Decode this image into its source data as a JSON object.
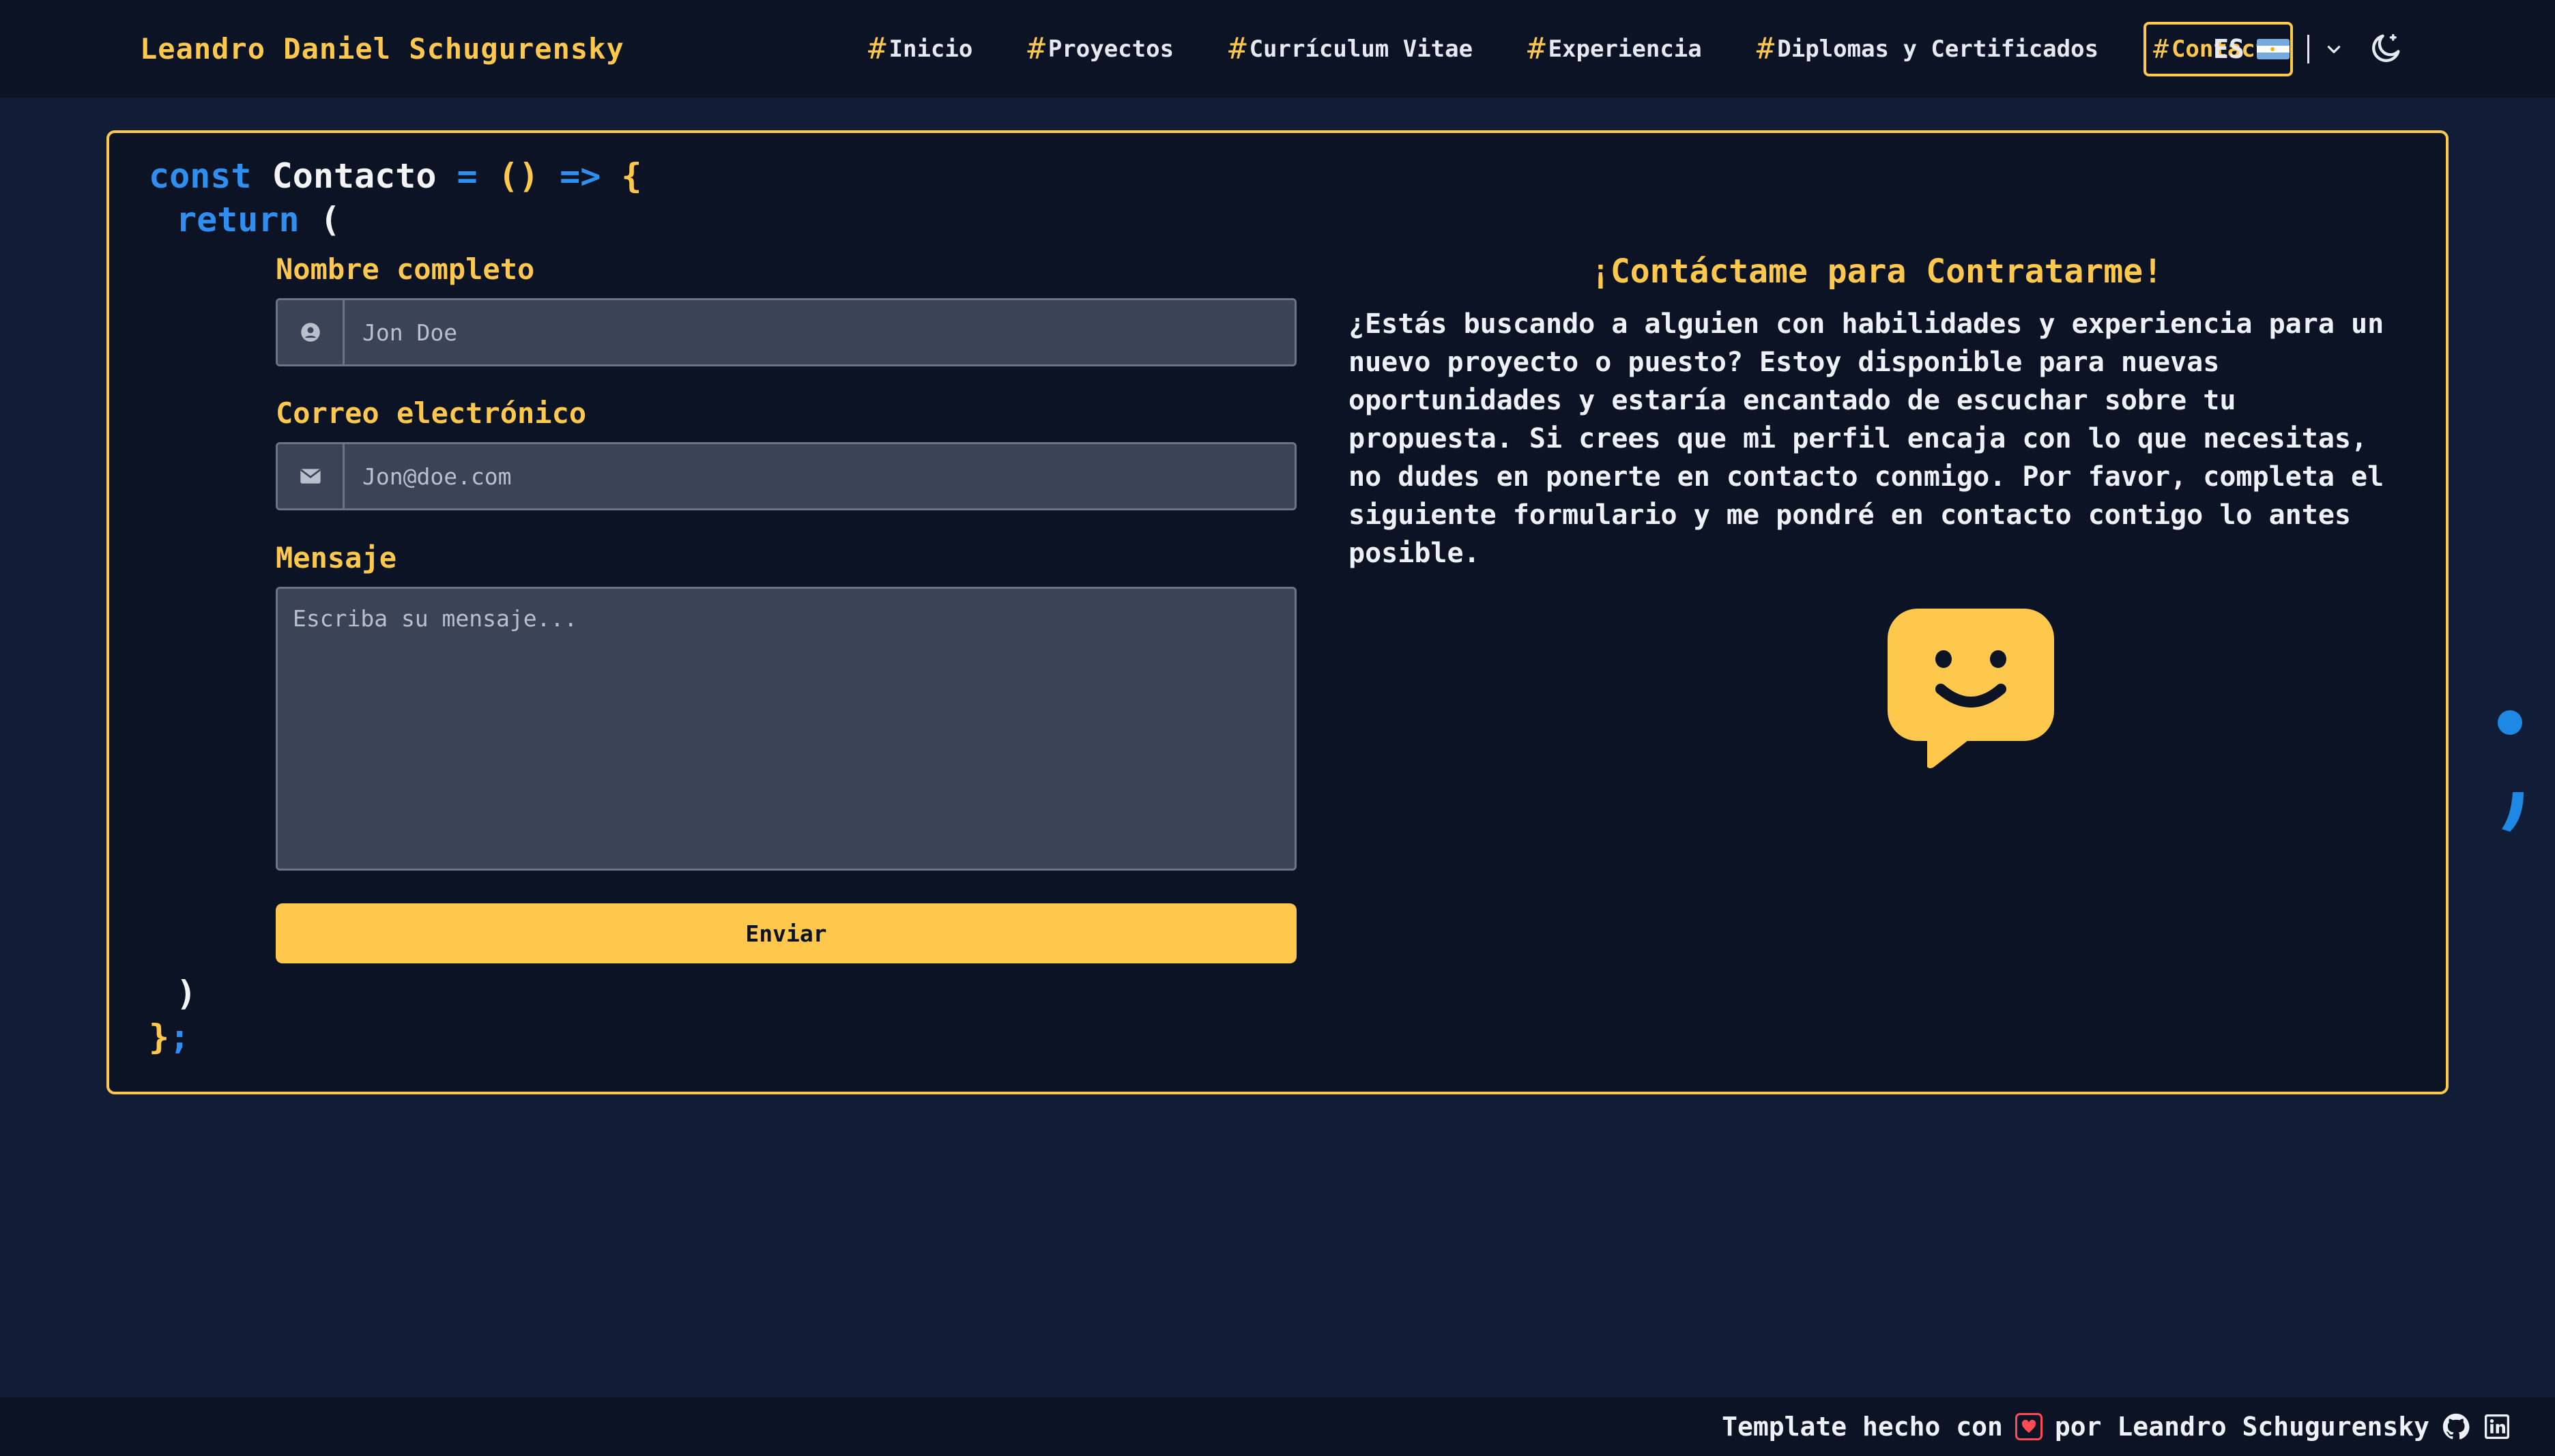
{
  "header": {
    "brand": "Leandro Daniel Schugurensky",
    "nav": [
      {
        "hash": "#",
        "label": "Inicio"
      },
      {
        "hash": "#",
        "label": "Proyectos"
      },
      {
        "hash": "#",
        "label": "Currículum Vitae"
      },
      {
        "hash": "#",
        "label": "Experiencia"
      },
      {
        "hash": "#",
        "label": "Diplomas y Certificados"
      },
      {
        "hash": "#",
        "label": "Contacto",
        "active": true
      }
    ],
    "language": {
      "code": "ES",
      "flag": "argentina-flag-icon"
    },
    "theme_toggle_icon": "moon-icon"
  },
  "code": {
    "const_kw": "const",
    "component_name": "Contacto",
    "assign": " = ",
    "parens": "()",
    "arrow": " => ",
    "open_brace": "{",
    "return_kw": "return",
    "open_paren": " (",
    "close_paren": ")",
    "close_brace": "}",
    "semicolon": ";"
  },
  "form": {
    "name_label": "Nombre completo",
    "name_placeholder": "Jon Doe",
    "name_icon": "user-circle-icon",
    "email_label": "Correo electrónico",
    "email_placeholder": "Jon@doe.com",
    "email_icon": "envelope-icon",
    "message_label": "Mensaje",
    "message_placeholder": "Escriba su mensaje...",
    "submit_label": "Enviar"
  },
  "contact": {
    "title": "¡Contáctame para Contratarme!",
    "text": "¿Estás buscando a alguien con habilidades y experiencia para un nuevo proyecto o puesto? Estoy disponible para nuevas oportunidades y estaría encantado de escuchar sobre tu propuesta. Si crees que mi perfil encaja con lo que necesitas, no dudes en ponerte en contacto conmigo. Por favor, completa el siguiente formulario y me pondré en contacto contigo lo antes posible.",
    "illustration_icon": "smiley-chat-bubble-icon"
  },
  "footer": {
    "text_before": "Template hecho con",
    "text_after": "por Leandro Schugurensky",
    "icons": [
      "heart-icon",
      "github-icon",
      "linkedin-icon"
    ]
  },
  "colors": {
    "page_bg": "#111d36",
    "panel_bg": "#0b1325",
    "accent": "#fec84d",
    "keyword": "#2f8ff0",
    "input_bg": "#3b4357"
  }
}
